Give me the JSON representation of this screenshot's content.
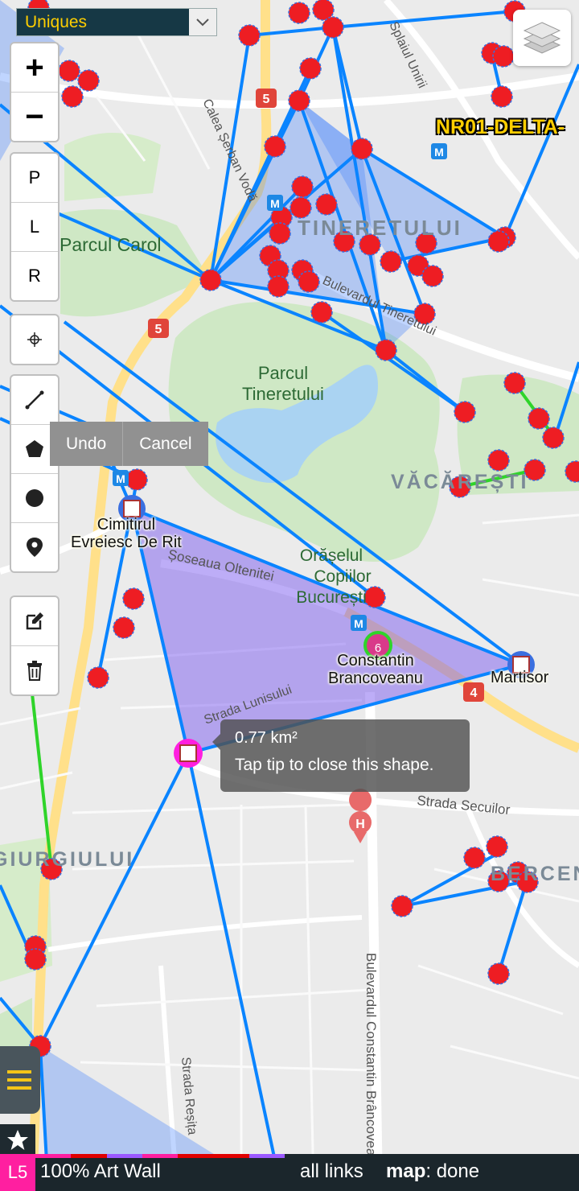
{
  "filter_select": {
    "value": "Uniques"
  },
  "zoom": {
    "in_label": "+",
    "out_label": "−"
  },
  "link_mode_buttons": {
    "p": "P",
    "l": "L",
    "r": "R"
  },
  "draw_actions": {
    "undo": "Undo",
    "cancel": "Cancel"
  },
  "tooltip": {
    "area": "0.77 km²",
    "hint": "Tap tip to close this shape."
  },
  "portals": {
    "cimitirul": "Cimitirul\nEvreiesc De Rit",
    "constantin": "Constantin\nBrancoveanu",
    "martisor": "Martisor",
    "constantin_badge": "6"
  },
  "op_label": "NR01-DELTA-",
  "map_labels": {
    "tineretului_district": "TINERETULUI",
    "parcul_tineretului": "Parcul\nTineretului",
    "parcul_carol": "Parcul Carol",
    "vacaresti": "VĂCĂREȘTI",
    "orasel": "Orășelul\nCopiilor\nBucurești",
    "giurgiului": "GIURGIULUI",
    "berceni": "BERCENI",
    "strada_secuilor": "Strada Secuilor",
    "bulevardul_brancoveanu": "Bulevardul Constantin Brâncoveanu",
    "bulevardul_tineretului": "Bulevardul Tineretului",
    "calea_serban_voda": "Calea Șerban Vodă",
    "splaiul_unirii": "Splaiul Unirii",
    "soseaua_oltenitei": "Șoseaua Oltenitei",
    "strada_resita": "Strada Reșița",
    "strada_lunisului": "Strada Lunisului",
    "route_5": "5",
    "route_4": "4",
    "metro": "M",
    "hospital": "H"
  },
  "status_bar": {
    "level": "L5",
    "name": "100% Art Wall",
    "links": "all links",
    "map_key": "map",
    "map_value": ": done"
  },
  "colors": {
    "link_blue": "#0a84ff",
    "field_fill": "#3b7dff",
    "portal_red": "#ee1d23",
    "draw_shape_fill": "#7b5cf0",
    "green_link": "#2fd42a",
    "level_pink": "#ff1fa0"
  }
}
